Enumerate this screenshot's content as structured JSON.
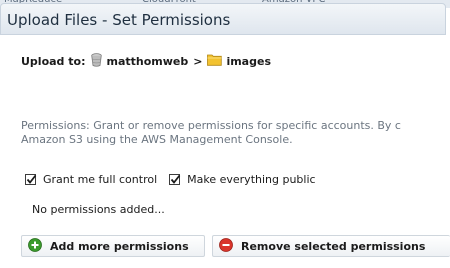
{
  "background_tabs": [
    "MapReduce",
    "CloudFront",
    "Amazon VPC"
  ],
  "dialog": {
    "title": "Upload Files - Set Permissions",
    "upload_to_label": "Upload to:",
    "bucket_name": "matthomweb",
    "path_separator": ">",
    "folder_name": "images",
    "permissions_description": "Permissions: Grant or remove permissions for specific accounts. By c",
    "permissions_description_line2": "Amazon S3 using the AWS Management Console.",
    "grant_full_control": {
      "label": "Grant me full control",
      "checked": true
    },
    "make_public": {
      "label": "Make everything public",
      "checked": true
    },
    "no_permissions_text": "No permissions added...",
    "add_button_label": "Add more permissions",
    "remove_button_label": "Remove selected permissions"
  },
  "icons": {
    "bucket": "bucket-icon",
    "folder": "folder-icon",
    "add": "plus-circle-icon",
    "remove": "minus-circle-icon",
    "checkmark": "checkmark-icon"
  },
  "colors": {
    "add_icon": "#3a9a2c",
    "remove_icon": "#d9352b",
    "folder": "#f2c230",
    "title_text": "#1f2f40",
    "description_text": "#6b7580"
  }
}
